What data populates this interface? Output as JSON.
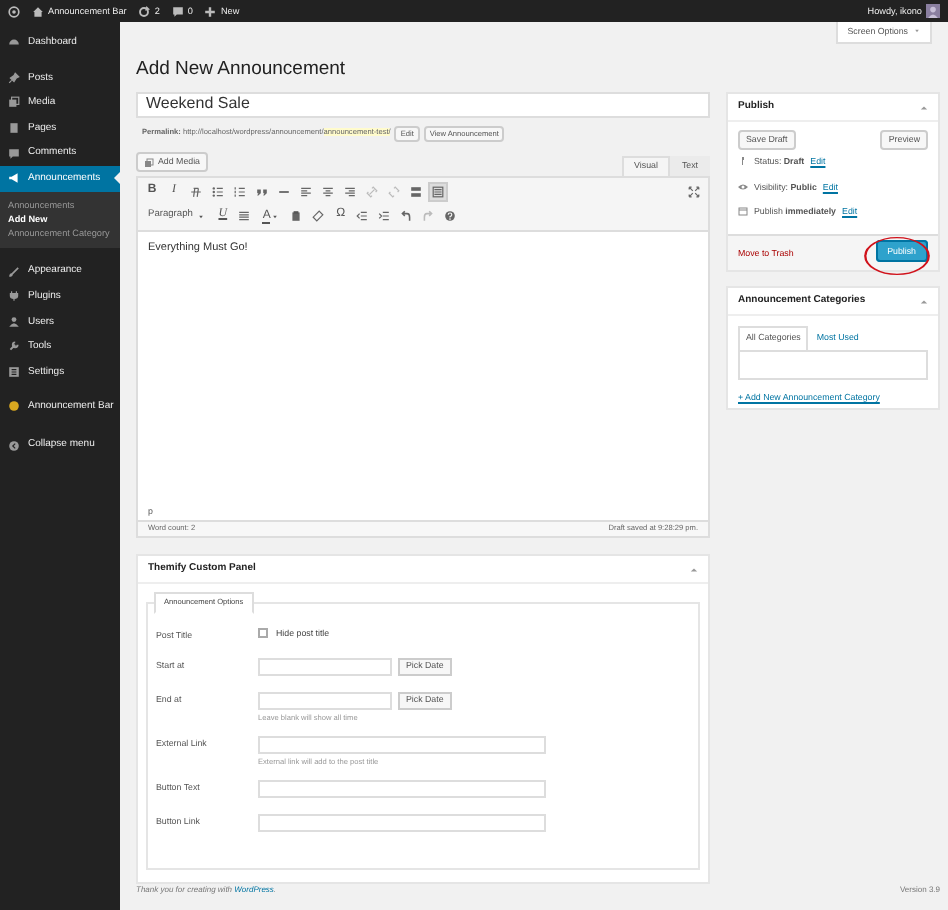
{
  "admin_bar": {
    "site": "Announcement Bar",
    "updates": "2",
    "comments": "0",
    "new": "New",
    "greeting": "Howdy, ikono"
  },
  "sidebar": {
    "items": [
      {
        "label": "Dashboard",
        "selected": false
      },
      {
        "label": "Posts",
        "selected": false
      },
      {
        "label": "Media",
        "selected": false
      },
      {
        "label": "Pages",
        "selected": false
      },
      {
        "label": "Comments",
        "selected": false
      },
      {
        "label": "Announcements",
        "selected": true,
        "children": [
          {
            "label": "Announcements",
            "selected": false
          },
          {
            "label": "Add New",
            "selected": true
          },
          {
            "label": "Announcement Category",
            "selected": false
          }
        ]
      },
      {
        "label": "Appearance",
        "selected": false
      },
      {
        "label": "Plugins",
        "selected": false
      },
      {
        "label": "Users",
        "selected": false
      },
      {
        "label": "Tools",
        "selected": false
      },
      {
        "label": "Settings",
        "selected": false
      },
      {
        "label": "Announcement Bar",
        "selected": false
      }
    ],
    "collapse": "Collapse menu"
  },
  "screen_options": "Screen Options",
  "page_title": "Add New Announcement",
  "post_title": "Weekend Sale",
  "permalink": {
    "label": "Permalink:",
    "base": "http://localhost/wordpress/announcement/",
    "slug": "announcement-test/",
    "buttons": [
      "Edit",
      "View Announcement"
    ]
  },
  "add_media": "Add Media",
  "editor_tabs": [
    {
      "label": "Visual",
      "selected": true
    },
    {
      "label": "Text",
      "selected": false
    }
  ],
  "toolbar": [
    [
      {
        "kind": "text",
        "label": "B",
        "pressed": false
      },
      {
        "kind": "text",
        "label": "I",
        "pressed": false
      },
      {
        "kind": "icon",
        "pressed": false
      },
      {
        "kind": "icon",
        "pressed": false
      },
      {
        "kind": "icon",
        "pressed": false
      },
      {
        "kind": "icon",
        "pressed": false
      },
      {
        "kind": "icon",
        "pressed": false
      },
      {
        "kind": "icon",
        "pressed": false
      },
      {
        "kind": "icon",
        "pressed": false
      },
      {
        "kind": "icon",
        "pressed": false
      },
      {
        "kind": "icon",
        "pressed": false
      },
      {
        "kind": "icon",
        "pressed": false
      },
      {
        "kind": "icon",
        "pressed": false
      },
      {
        "kind": "icon",
        "pressed": true
      }
    ],
    [
      {
        "kind": "select",
        "label": "Paragraph",
        "pressed": false
      },
      {
        "kind": "text",
        "label": "U",
        "pressed": false
      },
      {
        "kind": "icon",
        "pressed": false
      },
      {
        "kind": "color",
        "label": "A",
        "pressed": false
      },
      {
        "kind": "icon",
        "pressed": false
      },
      {
        "kind": "icon",
        "pressed": false
      },
      {
        "kind": "text",
        "label": "Ω",
        "pressed": false
      },
      {
        "kind": "icon",
        "pressed": false
      },
      {
        "kind": "icon",
        "pressed": false
      },
      {
        "kind": "icon",
        "pressed": false
      },
      {
        "kind": "icon",
        "pressed": false
      },
      {
        "kind": "icon",
        "pressed": false
      }
    ]
  ],
  "content": "Everything Must Go!",
  "path": "p",
  "word_count": "Word count: 2",
  "draft_saved": "Draft saved at 9:28:29 pm.",
  "themify": {
    "title": "Themify Custom Panel",
    "tabs": [
      {
        "label": "Announcement Options",
        "selected": true
      }
    ],
    "fields": [
      {
        "kind": "checkbox",
        "label": "Post Title",
        "option": "Hide post title",
        "checked": false
      },
      {
        "kind": "date",
        "label": "Start at",
        "button": "Pick Date"
      },
      {
        "kind": "date",
        "label": "End at",
        "button": "Pick Date",
        "hint": "Leave blank will show all time"
      },
      {
        "kind": "text",
        "label": "External Link",
        "hint": "External link will add to the post title"
      },
      {
        "kind": "text",
        "label": "Button Text"
      },
      {
        "kind": "text",
        "label": "Button Link"
      }
    ]
  },
  "publish": {
    "title": "Publish",
    "save_draft": "Save Draft",
    "preview": "Preview",
    "rows": [
      {
        "label": "Status:",
        "value": "Draft",
        "edit": "Edit"
      },
      {
        "label": "Visibility:",
        "value": "Public",
        "edit": "Edit"
      },
      {
        "label": "Publish",
        "value": "immediately",
        "edit": "Edit"
      }
    ],
    "trash": "Move to Trash",
    "button": "Publish",
    "circled": true
  },
  "categories": {
    "title": "Announcement Categories",
    "tabs": [
      {
        "label": "All Categories",
        "selected": true
      },
      {
        "label": "Most Used",
        "selected": false
      }
    ],
    "add_link": "+ Add New Announcement Category"
  },
  "footer": {
    "text": "Thank you for creating with",
    "link": "WordPress",
    "after": ".",
    "version": "Version 3.9"
  }
}
